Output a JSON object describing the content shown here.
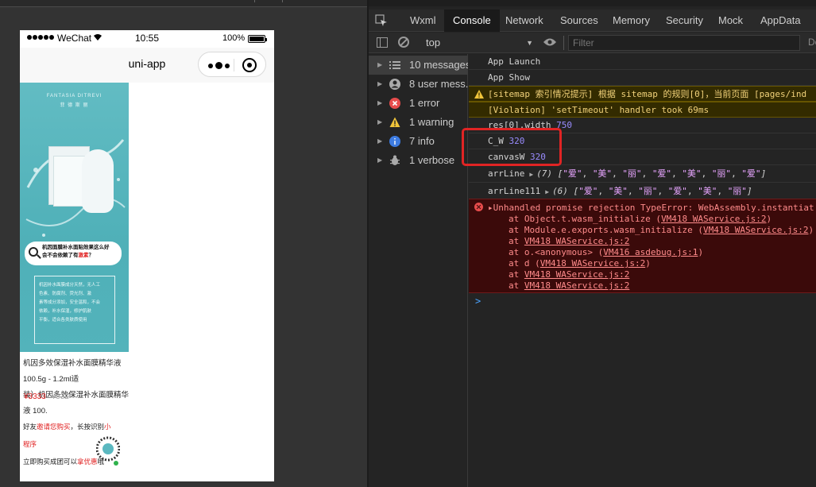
{
  "simulator": {
    "status_bar": {
      "carrier": "WeChat",
      "time": "10:55",
      "battery_percent": "100%"
    },
    "nav_title": "uni-app",
    "poster": {
      "brand_line1": "FANTASIA DITREVI",
      "brand_line2": "菲 德 斯 丽",
      "callout_line1": "机因面膜补水面贴效果这么好",
      "callout_line2_prefix": "会不会依赖了有",
      "callout_line2_highlight": "激素",
      "callout_line2_suffix": "？",
      "text_lines": [
        "机因补水面膜成分天然，无人工",
        "色素、防腐剂、荧光剂、激",
        "素等成分添加，安全温和，不会",
        "依赖，补水保湿，修护肌肤",
        "平衡，适合各类肤质使用"
      ]
    },
    "product_desc_line1": "机因多效保湿补水面膜精华液 100.5g - 1.2ml适",
    "product_desc_line2": "装）机因多效保湿补水面膜精华液 100.",
    "price": "¥3333",
    "old_price": "¥332",
    "share_line1_prefix": "好友",
    "share_line1_red": "邀请您购买",
    "share_line1_mid": "，长按识别",
    "share_line1_tail": "小程序",
    "share_line2_prefix": "立即购买成团可以",
    "share_line2_red": "拿优惠",
    "share_line2_suffix": "哦"
  },
  "devtools": {
    "tabs": [
      "Wxml",
      "Console",
      "Network",
      "Sources",
      "Memory",
      "Security",
      "Mock",
      "AppData"
    ],
    "active_tab": "Console",
    "context_select": "top",
    "filter_placeholder": "Filter",
    "default_levels": "De",
    "sidebar": [
      {
        "label": "10 messages",
        "icon": "list-icon"
      },
      {
        "label": "8 user mess...",
        "icon": "user-icon"
      },
      {
        "label": "1 error",
        "icon": "error-icon"
      },
      {
        "label": "1 warning",
        "icon": "warning-icon"
      },
      {
        "label": "7 info",
        "icon": "info-icon"
      },
      {
        "label": "1 verbose",
        "icon": "bug-icon"
      }
    ],
    "console": {
      "l1": "App Launch",
      "l2": "App Show",
      "warn1": "[sitemap 索引情况提示] 根据 sitemap 的规则[0]，当前页面 [pages/ind",
      "warn2": "[Violation] 'setTimeout' handler took 69ms",
      "l5_key": "res[0].width",
      "l5_val": "750",
      "l6_key": "C_W",
      "l6_val": "320",
      "l7_key": "canvasW",
      "l7_val": "320",
      "l8_key": "arrLine",
      "l8_count": "(7)",
      "l8_items": [
        "\"爱\"",
        "\"美\"",
        "\"丽\"",
        "\"爱\"",
        "\"美\"",
        "\"丽\"",
        "\"爱\""
      ],
      "l9_key": "arrLine111",
      "l9_count": "(6)",
      "l9_items": [
        "\"爱\"",
        "\"美\"",
        "\"丽\"",
        "\"爱\"",
        "\"美\"",
        "\"丽\""
      ],
      "error_head": "Unhandled promise rejection TypeError: WebAssembly.instantiat",
      "stack": [
        {
          "pre": "at Object.t.wasm_initialize (",
          "link": "VM418 WAService.js:2",
          "post": ")"
        },
        {
          "pre": "at Module.e.exports.wasm_initialize (",
          "link": "VM418 WAService.js:2",
          "post": ")"
        },
        {
          "pre": "at ",
          "link": "VM418 WAService.js:2",
          "post": ""
        },
        {
          "pre": "at o.<anonymous> (",
          "link": "VM416 asdebug.js:1",
          "post": ")"
        },
        {
          "pre": "at d (",
          "link": "VM418 WAService.js:2",
          "post": ")"
        },
        {
          "pre": "at ",
          "link": "VM418 WAService.js:2",
          "post": ""
        },
        {
          "pre": "at ",
          "link": "VM418 WAService.js:2",
          "post": ""
        }
      ],
      "prompt": ">"
    }
  },
  "colors": {
    "annotation_box": "#e02424",
    "poster_teal": "#55b5bd",
    "price_red": "#e02020"
  }
}
